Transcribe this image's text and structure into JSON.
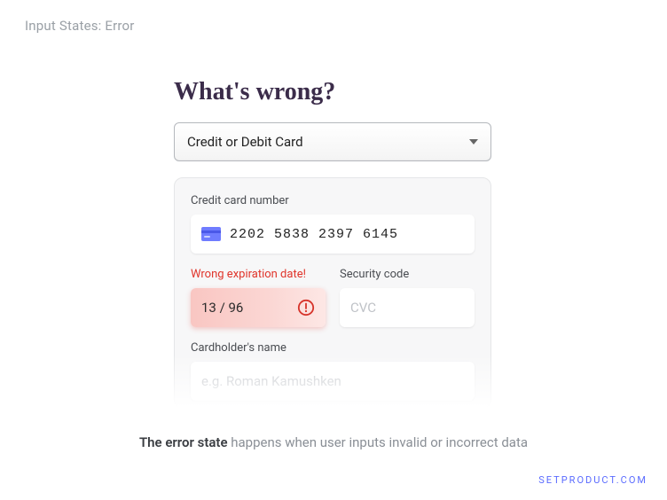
{
  "header": {
    "label": "Input States: Error"
  },
  "title": "What's wrong?",
  "payment_method": {
    "selected": "Credit or Debit Card"
  },
  "card": {
    "number_label": "Credit card number",
    "number_value": "2202 5838 2397 6145",
    "expiry_error_label": "Wrong expiration date!",
    "expiry_value": "13 / 96",
    "cvc_label": "Security code",
    "cvc_placeholder": "CVC",
    "name_label": "Cardholder's name",
    "name_placeholder": "e.g. Roman Kamushken"
  },
  "caption": {
    "strong": "The error state",
    "rest": " happens when user inputs invalid or incorrect data"
  },
  "brand": "SETPRODUCT.COM"
}
